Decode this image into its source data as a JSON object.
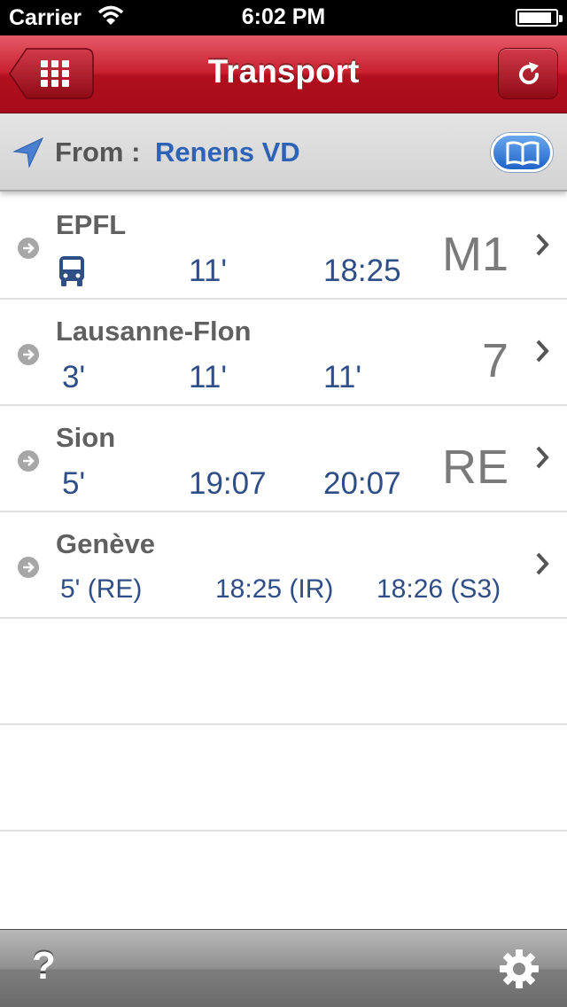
{
  "status_bar": {
    "carrier": "Carrier",
    "time": "6:02 PM",
    "battery_level": 0.92
  },
  "navbar": {
    "title": "Transport",
    "left_icon": "grid-menu-icon",
    "right_icon": "refresh-icon"
  },
  "from_bar": {
    "label": "From :",
    "value": "Renens VD",
    "right_icon": "book-icon"
  },
  "rows": [
    {
      "destination": "EPFL",
      "times": [
        "11'",
        "18:25"
      ],
      "line": "M1",
      "icon": "bus-icon"
    },
    {
      "destination": "Lausanne-Flon",
      "times": [
        "3'",
        "11'",
        "11'"
      ],
      "line": "7"
    },
    {
      "destination": "Sion",
      "times": [
        "5'",
        "19:07",
        "20:07"
      ],
      "line": "RE"
    },
    {
      "destination": "Genève",
      "times": [
        "5' (RE)",
        "18:25 (IR)",
        "18:26 (S3)"
      ],
      "line": ""
    }
  ],
  "toolbar": {
    "help_label": "?",
    "settings_icon": "gear-icon"
  },
  "colors": {
    "nav_red": "#c8202f",
    "link_blue": "#2d63b6",
    "time_blue": "#2f4e86"
  }
}
